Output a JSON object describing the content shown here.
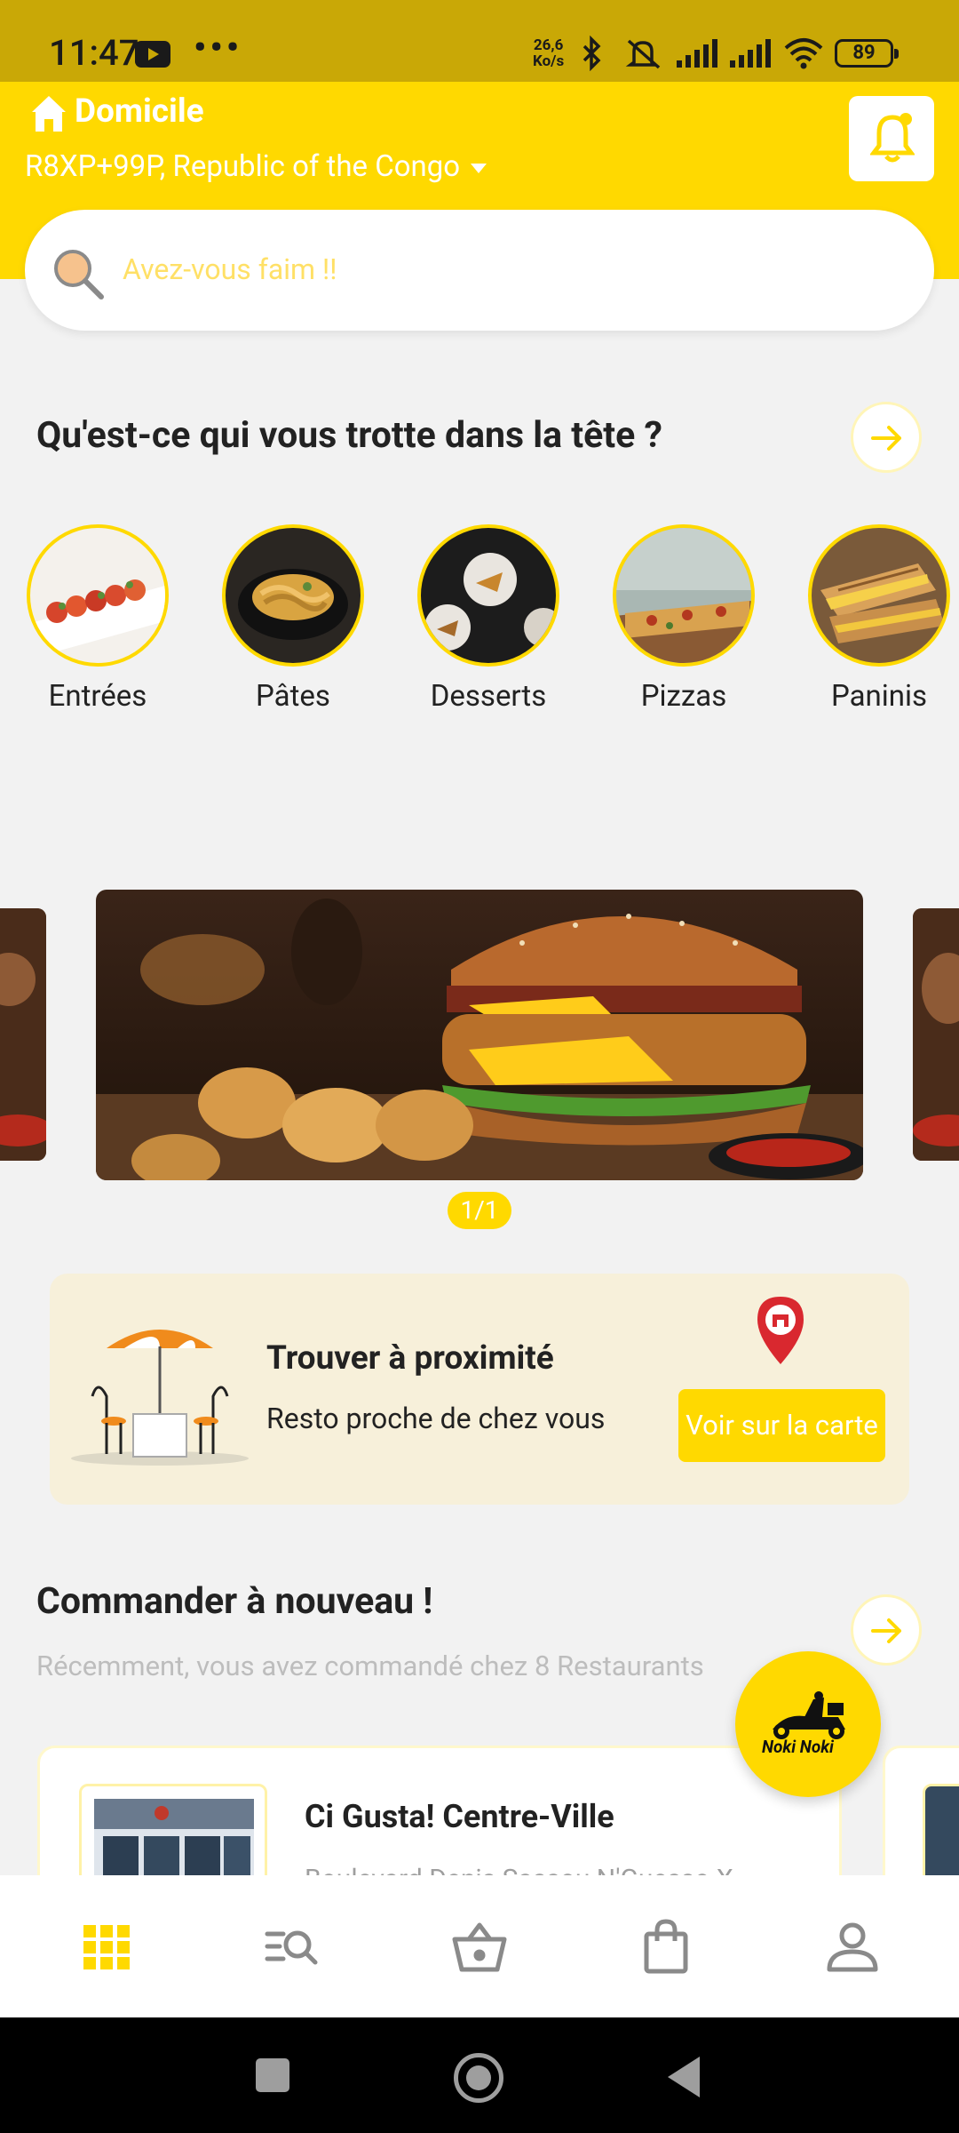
{
  "status_bar": {
    "time": "11:47",
    "more": "•••",
    "speed_top": "26,6",
    "speed_bottom": "Ko/s",
    "battery": "89"
  },
  "header": {
    "title": "Domicile",
    "address": "R8XP+99P, Republic of the Congo"
  },
  "search": {
    "placeholder": "Avez-vous faim !!"
  },
  "categories_section": {
    "title": "Qu'est-ce qui vous trotte dans la tête ?",
    "items": [
      {
        "label": "Entrées"
      },
      {
        "label": "Pâtes"
      },
      {
        "label": "Desserts"
      },
      {
        "label": "Pizzas"
      },
      {
        "label": "Paninis"
      }
    ]
  },
  "banner": {
    "pager": "1/1"
  },
  "nearby": {
    "title": "Trouver à proximité",
    "subtitle": "Resto proche de chez vous",
    "button": "Voir sur la carte"
  },
  "reorder": {
    "title": "Commander à nouveau !",
    "subtitle": "Récemment, vous avez commandé chez 8 Restaurants",
    "restaurants": [
      {
        "name": "Ci Gusta! Centre-Ville",
        "address": "Boulevard Denis Sassou N'Guesso X"
      }
    ]
  },
  "fab": {
    "logo": "Noki Noki"
  },
  "colors": {
    "brand_yellow": "#ffd900",
    "status_bar": "#c9a806"
  },
  "bottom_nav": [
    {
      "icon": "grid-icon",
      "active": true
    },
    {
      "icon": "search-list-icon",
      "active": false
    },
    {
      "icon": "basket-icon",
      "active": false
    },
    {
      "icon": "shopping-bag-icon",
      "active": false
    },
    {
      "icon": "user-icon",
      "active": false
    }
  ]
}
